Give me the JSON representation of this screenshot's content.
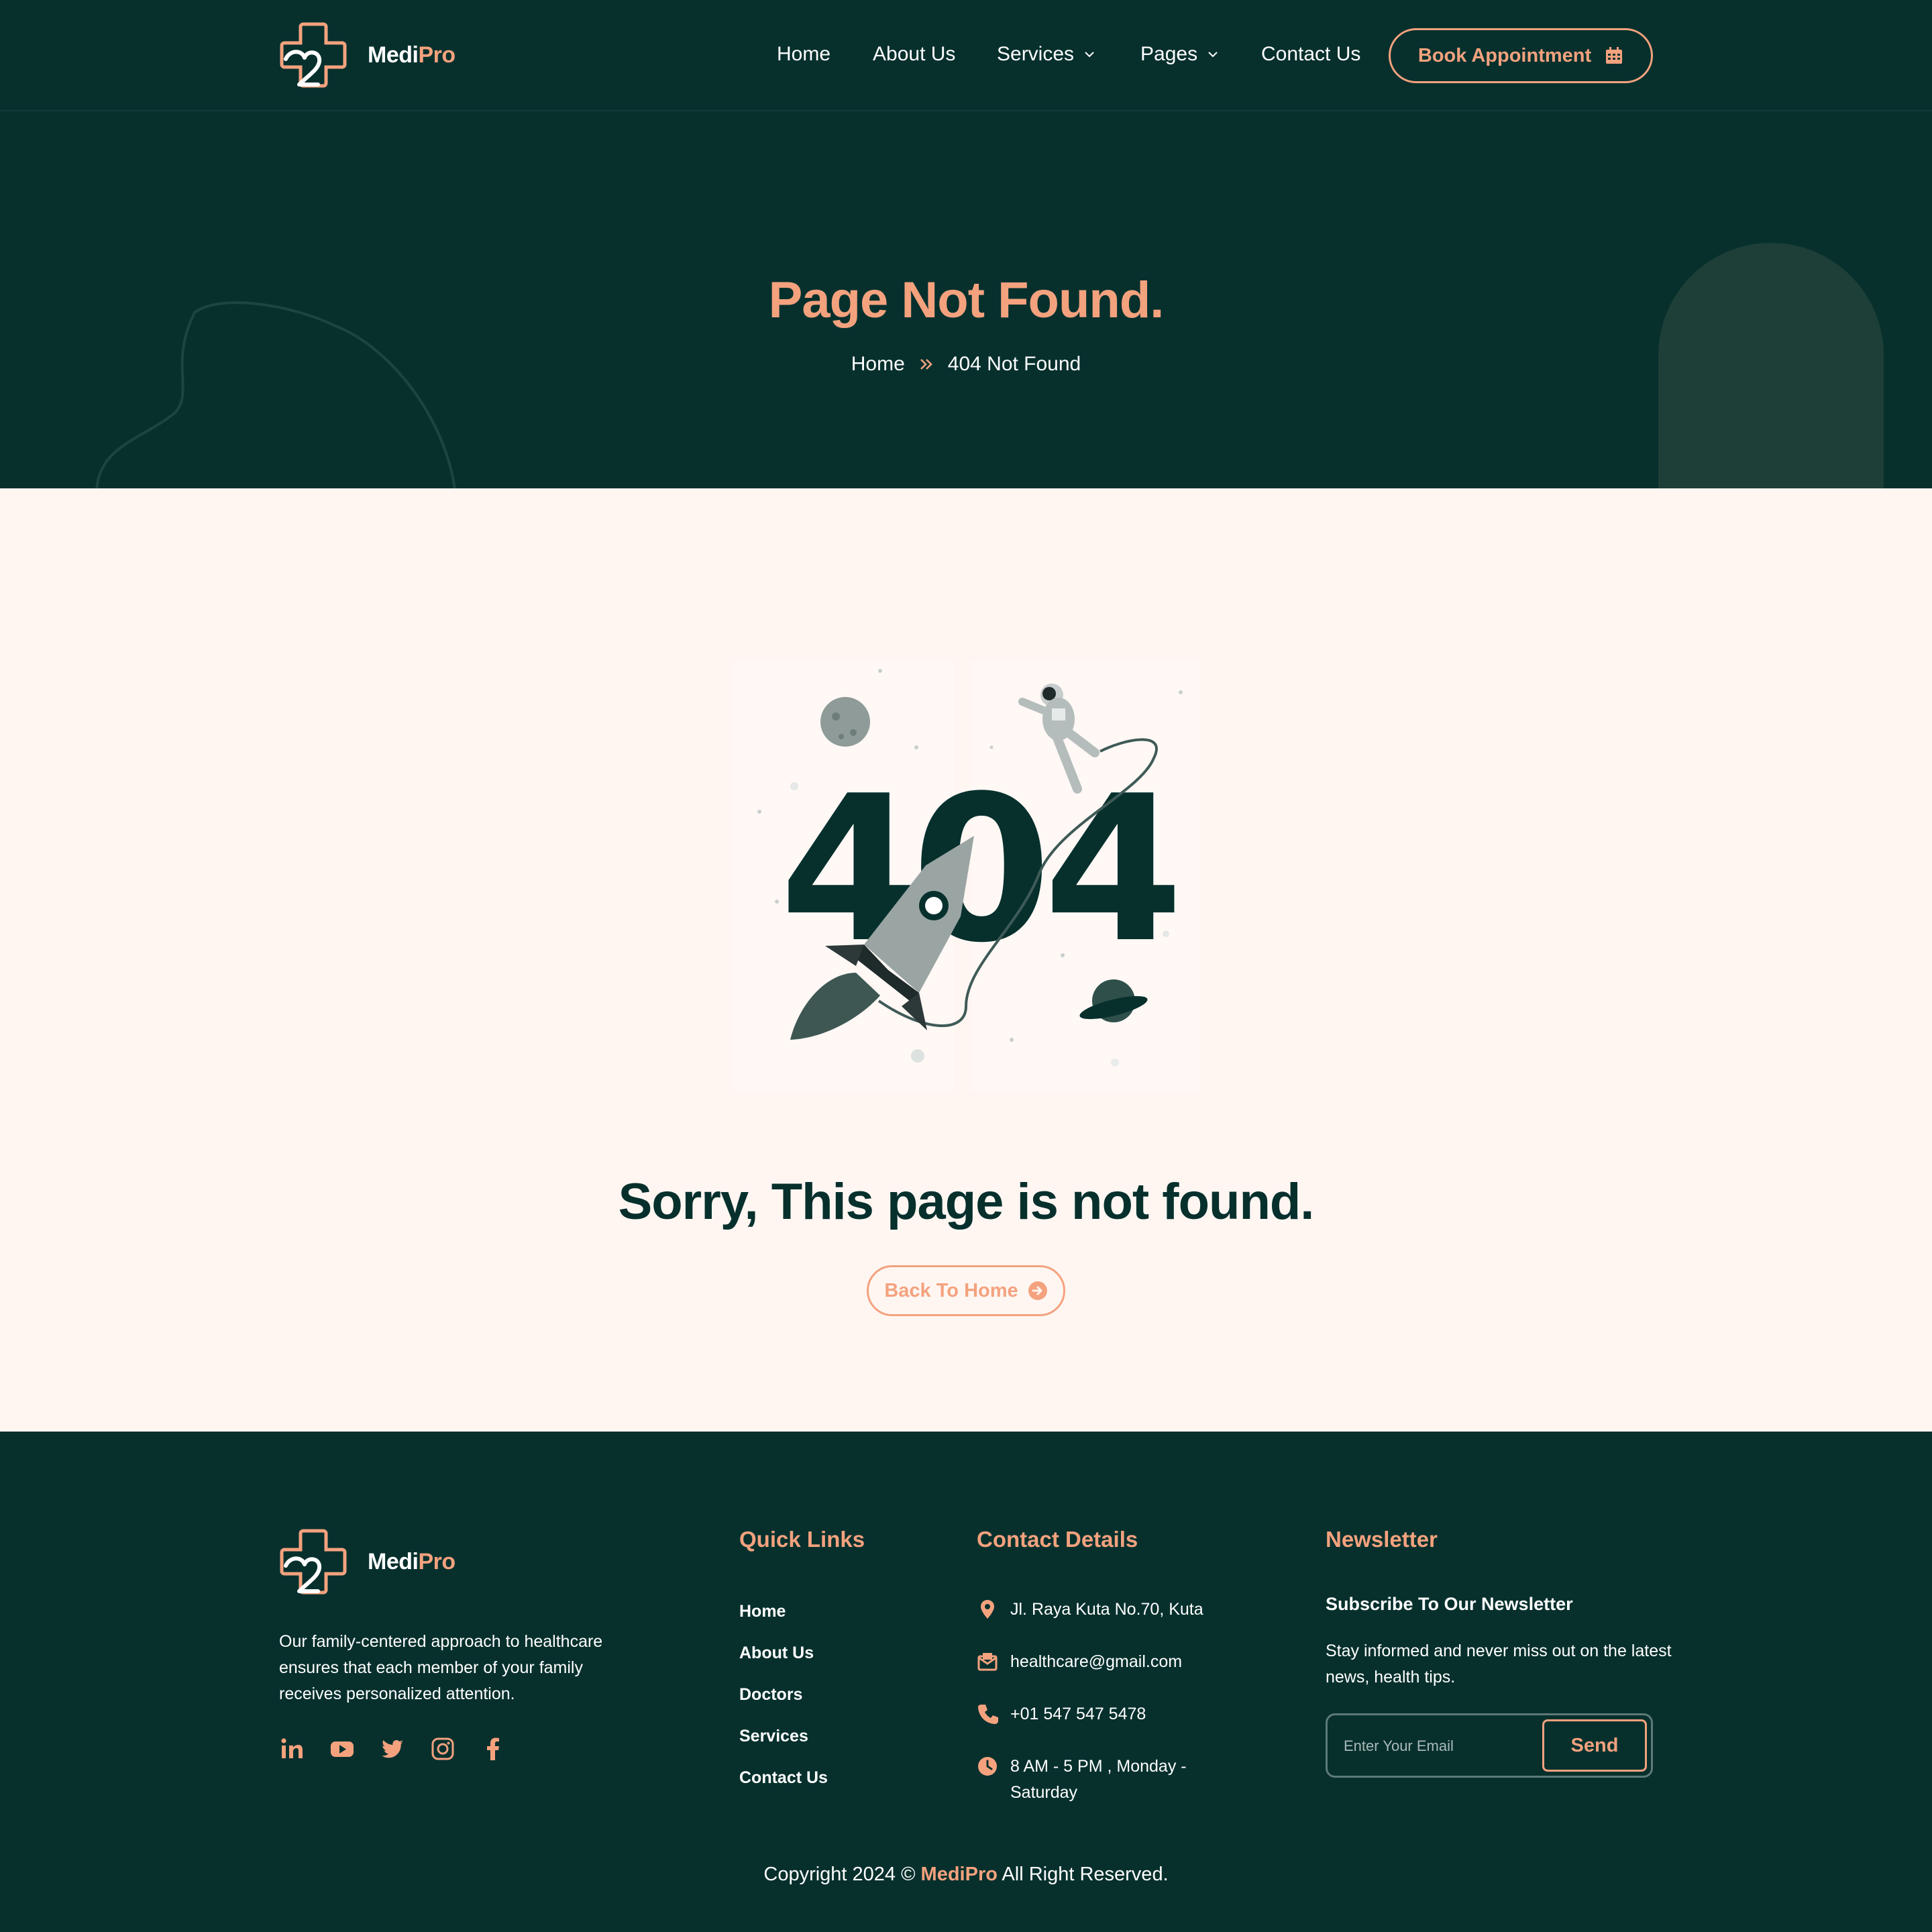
{
  "brand": {
    "name_part1": "Medi",
    "name_part2": "Pro"
  },
  "nav": {
    "home": "Home",
    "about": "About Us",
    "services": "Services",
    "pages": "Pages",
    "contact": "Contact Us",
    "book": "Book Appointment"
  },
  "hero": {
    "title": "Page Not Found.",
    "breadcrumb_home": "Home",
    "breadcrumb_current": "404 Not Found"
  },
  "main": {
    "illustration_text": "404",
    "heading": "Sorry, This page is not found.",
    "back_button": "Back To Home"
  },
  "footer": {
    "about": "Our family-centered approach to healthcare ensures that each member of your family receives personalized attention.",
    "socials": [
      "linkedin-icon",
      "youtube-icon",
      "twitter-icon",
      "instagram-icon",
      "facebook-icon"
    ],
    "quick_links_heading": "Quick Links",
    "quick_links": [
      "Home",
      "About Us",
      "Doctors",
      "Services",
      "Contact Us"
    ],
    "contact_heading": "Contact Details",
    "address": "Jl. Raya Kuta No.70, Kuta",
    "email": "healthcare@gmail.com",
    "phone": "+01 547 547 5478",
    "hours_line1": "8 AM - 5 PM , Monday -",
    "hours_line2": "Saturday",
    "newsletter_heading": "Newsletter",
    "newsletter_sub": "Subscribe To Our Newsletter",
    "newsletter_text": "Stay informed and never miss out on the latest news, health tips.",
    "email_placeholder": "Enter Your Email",
    "send": "Send",
    "copyright_pre": "Copyright 2024 © ",
    "copyright_brand": "MediPro",
    "copyright_post": " All Right Reserved."
  },
  "colors": {
    "dark": "#07302D",
    "accent": "#F4A27E",
    "cream": "#FFF6F2"
  }
}
